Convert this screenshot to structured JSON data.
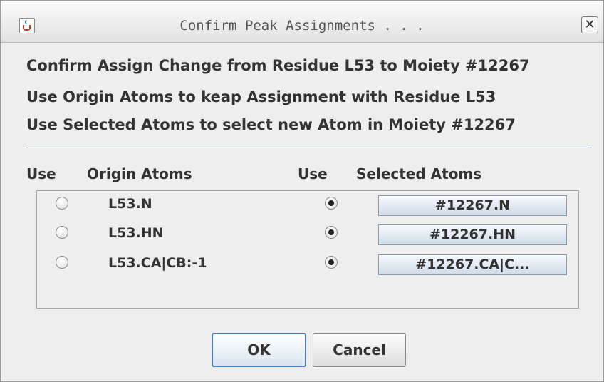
{
  "window": {
    "title": "Confirm Peak Assignments . . . ",
    "icon": "java-app-icon",
    "close_symbol": "✕"
  },
  "messages": [
    "Confirm Assign Change from Residue L53 to Moiety #12267",
    "Use Origin Atoms to keap Assignment with Residue L53",
    "Use Selected Atoms to select new Atom in Moiety #12267"
  ],
  "columns": {
    "use_origin": "Use",
    "origin_atoms": "Origin Atoms",
    "use_selected": "Use",
    "selected_atoms": "Selected Atoms"
  },
  "rows": [
    {
      "origin": "L53.N",
      "origin_selected": false,
      "selected": "#12267.N",
      "selected_selected": true
    },
    {
      "origin": "L53.HN",
      "origin_selected": false,
      "selected": "#12267.HN",
      "selected_selected": true
    },
    {
      "origin": "L53.CA|CB:-1",
      "origin_selected": false,
      "selected": "#12267.CA|C...",
      "selected_selected": true
    }
  ],
  "buttons": {
    "ok": "OK",
    "cancel": "Cancel"
  },
  "colors": {
    "accent": "#4f7fb8",
    "separator": "#5a7fb5",
    "background": "#eeeeee"
  }
}
